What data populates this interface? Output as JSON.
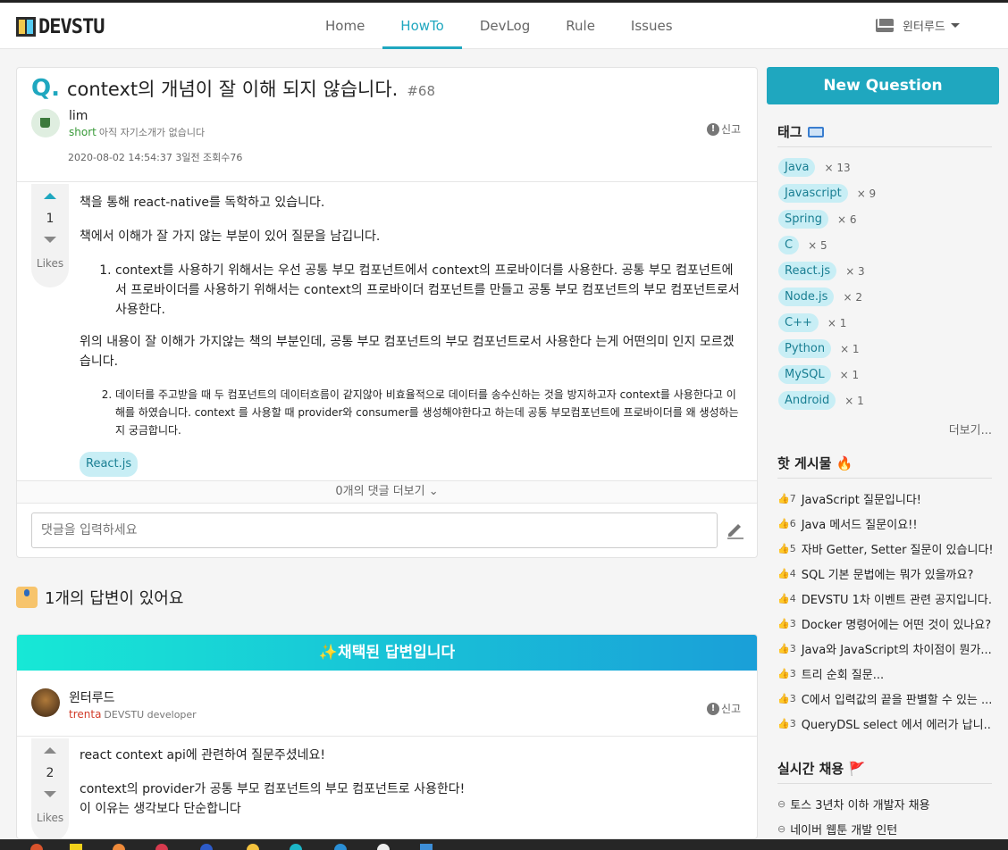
{
  "brand": {
    "logo_text": "DEVSTU"
  },
  "nav": {
    "items": [
      {
        "label": "Home",
        "active": false
      },
      {
        "label": "HowTo",
        "active": true
      },
      {
        "label": "DevLog",
        "active": false
      },
      {
        "label": "Rule",
        "active": false
      },
      {
        "label": "Issues",
        "active": false
      }
    ],
    "user_name": "윈터루드"
  },
  "question": {
    "mark": "Q.",
    "title": "context의 개념이 잘 이해 되지 않습니다.",
    "number": "#68",
    "author": {
      "name": "lim",
      "grade": "short",
      "bio": "아직 자기소개가 없습니다"
    },
    "meta": "2020-08-02 14:54:37 3일전 조회수76",
    "report_label": "신고",
    "votes": "1",
    "likes_label": "Likes",
    "body": {
      "p1": "책을 통해 react-native를 독학하고 있습니다.",
      "p2": "책에서 이해가 잘 가지 않는 부분이 있어 질문을 남깁니다.",
      "li1": "context를 사용하기 위해서는 우선 공통 부모 컴포넌트에서 context의 프로바이더를 사용한다. 공통 부모 컴포넌트에서 프로바이더를 사용하기 위해서는 context의 프로바이더 컴포넌트를 만들고 공통 부모 컴포넌트의 부모 컴포넌트로서 사용한다.",
      "p3": "위의 내용이 잘 이해가 가지않는 책의 부분인데, 공통 부모 컴포넌트의 부모 컴포넌트로서 사용한다 는게 어떤의미 인지 모르겠습니다.",
      "li2": "데이터를 주고받을 때 두 컴포넌트의 데이터흐름이 같지않아 비효율적으로 데이터를 송수신하는 것을 방지하고자 context를 사용한다고 이해를 하였습니다. context 를 사용할 때 provider와 consumer를 생성해야한다고 하는데 공통 부모컴포넌트에 프로바이더를 왜 생성하는지 궁금합니다."
    },
    "tag": "React.js",
    "comments_more": "0개의 댓글 더보기",
    "comment_placeholder": "댓글을 입력하세요"
  },
  "answers": {
    "count_label": "1개의 답변이 있어요",
    "accepted_label": "✨채택된 답변입니다",
    "author": {
      "name": "윈터루드",
      "grade": "trenta",
      "bio": "DEVSTU developer"
    },
    "report_label": "신고",
    "votes": "2",
    "likes_label": "Likes",
    "body": {
      "p1": "react context api에 관련하여 질문주셨네요!",
      "p2": "context의 provider가 공통 부모 컴포넌트의 부모 컴포넌트로 사용한다!",
      "p3": "이 이유는 생각보다 단순합니다"
    }
  },
  "sidebar": {
    "new_question": "New Question",
    "tags_title": "태그",
    "tags": [
      {
        "name": "Java",
        "count": "× 13"
      },
      {
        "name": "Javascript",
        "count": "× 9"
      },
      {
        "name": "Spring",
        "count": "× 6"
      },
      {
        "name": "C",
        "count": "× 5"
      },
      {
        "name": "React.js",
        "count": "× 3"
      },
      {
        "name": "Node.js",
        "count": "× 2"
      },
      {
        "name": "C++",
        "count": "× 1"
      },
      {
        "name": "Python",
        "count": "× 1"
      },
      {
        "name": "MySQL",
        "count": "× 1"
      },
      {
        "name": "Android",
        "count": "× 1"
      }
    ],
    "more": "더보기...",
    "hot_title": "핫 게시물 🔥",
    "hot_posts": [
      {
        "likes": "7",
        "title": "JavaScript 질문입니다!"
      },
      {
        "likes": "6",
        "title": "Java 메서드 질문이요!!"
      },
      {
        "likes": "5",
        "title": "자바 Getter, Setter 질문이 있습니다!"
      },
      {
        "likes": "4",
        "title": "SQL 기본 문법에는 뭐가 있을까요?"
      },
      {
        "likes": "4",
        "title": "DEVSTU 1차 이벤트 관련 공지입니다."
      },
      {
        "likes": "3",
        "title": "Docker 명령어에는 어떤 것이 있나요?"
      },
      {
        "likes": "3",
        "title": "Java와 JavaScript의 차이점이 뭔가..."
      },
      {
        "likes": "3",
        "title": "트리 순회 질문..."
      },
      {
        "likes": "3",
        "title": "C에서 입력값의 끝을 판별할 수 있는 ..."
      },
      {
        "likes": "3",
        "title": "QueryDSL select 에서 에러가 납니..."
      }
    ],
    "jobs_title": "실시간 채용 🚩",
    "jobs": [
      {
        "title": "토스 3년차 이하 개발자 채용"
      },
      {
        "title": "네이버 웹툰 개발 인턴"
      }
    ]
  }
}
